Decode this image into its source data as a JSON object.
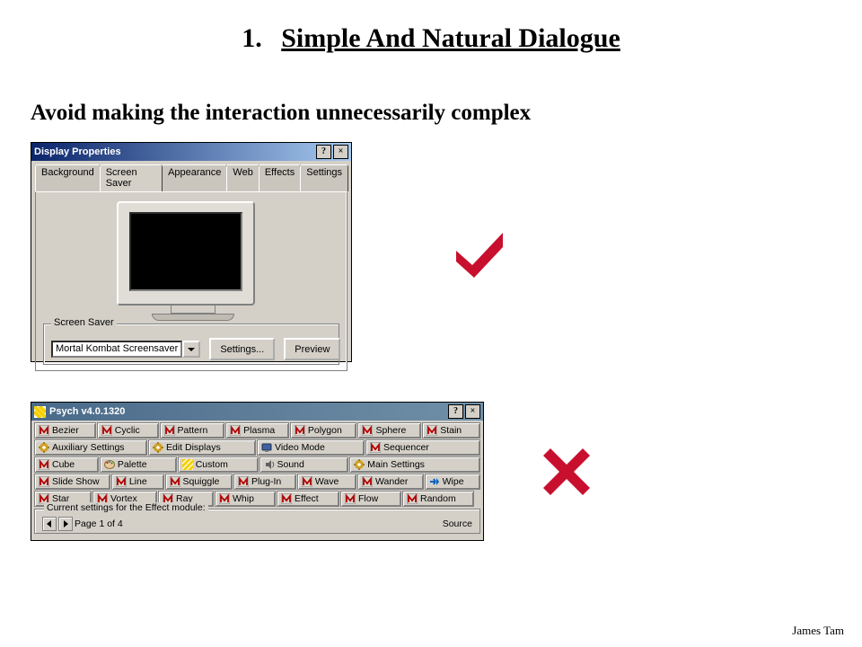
{
  "title": {
    "number": "1.",
    "text": "Simple And Natural Dialogue"
  },
  "subtitle": "Avoid making the interaction unnecessarily complex",
  "good": {
    "window_title": "Display Properties",
    "tabs": [
      "Background",
      "Screen Saver",
      "Appearance",
      "Web",
      "Effects",
      "Settings"
    ],
    "active_tab_index": 1,
    "group_label": "Screen Saver",
    "screensaver_value": "Mortal Kombat Screensaver",
    "settings_btn": "Settings...",
    "preview_btn": "Preview"
  },
  "bad": {
    "window_title": "Psych v4.0.1320",
    "rows": [
      [
        {
          "k": "m",
          "t": "Bezier"
        },
        {
          "k": "m",
          "t": "Cyclic"
        },
        {
          "k": "m",
          "t": "Pattern"
        },
        {
          "k": "m",
          "t": "Plasma"
        },
        {
          "k": "m",
          "t": "Polygon"
        },
        {
          "k": "m",
          "t": "Sphere"
        },
        {
          "k": "m",
          "t": "Stain"
        }
      ],
      [
        {
          "k": "g",
          "t": "Auxiliary Settings"
        },
        {
          "k": "g",
          "t": "Edit Displays"
        },
        {
          "k": "v",
          "t": "Video Mode"
        },
        {
          "k": "m",
          "t": "Sequencer"
        }
      ],
      [
        {
          "k": "m",
          "t": "Cube"
        },
        {
          "k": "p",
          "t": "Palette"
        },
        {
          "k": "y",
          "t": "Custom"
        },
        {
          "k": "s",
          "t": "Sound"
        },
        {
          "k": "g",
          "t": "Main Settings"
        }
      ],
      [
        {
          "k": "m",
          "t": "Slide Show"
        },
        {
          "k": "m",
          "t": "Line"
        },
        {
          "k": "m",
          "t": "Squiggle"
        },
        {
          "k": "m",
          "t": "Plug-In"
        },
        {
          "k": "m",
          "t": "Wave"
        },
        {
          "k": "m",
          "t": "Wander"
        },
        {
          "k": "a",
          "t": "Wipe"
        }
      ],
      [
        {
          "k": "m",
          "t": "Star"
        },
        {
          "k": "m",
          "t": "Vortex"
        },
        {
          "k": "m",
          "t": "Ray"
        },
        {
          "k": "m",
          "t": "Whip"
        },
        {
          "k": "m",
          "t": "Effect"
        },
        {
          "k": "m",
          "t": "Flow"
        },
        {
          "k": "m",
          "t": "Random"
        }
      ]
    ],
    "group_label": "Current settings for the Effect module:",
    "page_text": "Page 1 of 4",
    "source_text": "Source"
  },
  "annotations": {
    "good": "check-icon",
    "bad": "cross-icon"
  },
  "footer": "James Tam",
  "colors": {
    "annot": "#c8102e"
  }
}
